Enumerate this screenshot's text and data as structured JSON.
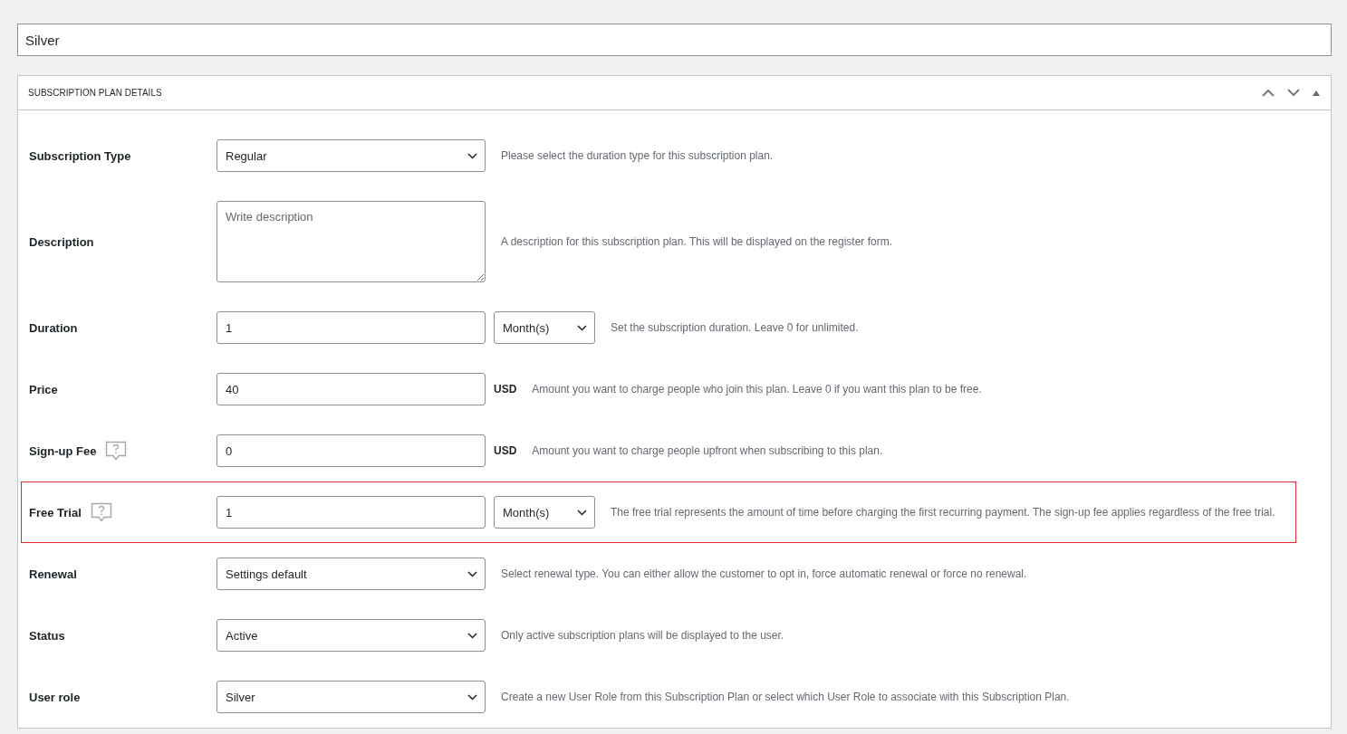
{
  "title_field": {
    "value": "Silver"
  },
  "panel": {
    "title": "SUBSCRIPTION PLAN DETAILS",
    "expanded": true,
    "rows": [
      {
        "kind": "select",
        "label": "Subscription Type",
        "help": false,
        "highlighted": false,
        "value": "Regular",
        "description": "Please select the duration type for this subscription plan."
      },
      {
        "kind": "textarea",
        "label": "Description",
        "help": false,
        "highlighted": false,
        "placeholder": "Write description",
        "description": "A description for this subscription plan. This will be displayed on the register form."
      },
      {
        "kind": "number-unit",
        "label": "Duration",
        "help": false,
        "highlighted": false,
        "value": "1",
        "unit": "Month(s)",
        "description": "Set the subscription duration. Leave 0 for unlimited."
      },
      {
        "kind": "number-currency",
        "label": "Price",
        "help": false,
        "highlighted": false,
        "value": "40",
        "currency": "USD",
        "description": "Amount you want to charge people who join this plan. Leave 0 if you want this plan to be free."
      },
      {
        "kind": "number-currency",
        "label": "Sign-up Fee",
        "help": true,
        "highlighted": false,
        "value": "0",
        "currency": "USD",
        "description": "Amount you want to charge people upfront when subscribing to this plan."
      },
      {
        "kind": "number-unit",
        "label": "Free Trial",
        "help": true,
        "highlighted": true,
        "value": "1",
        "unit": "Month(s)",
        "description": "The free trial represents the amount of time before charging the first recurring payment. The sign-up fee applies regardless of the free trial."
      },
      {
        "kind": "select",
        "label": "Renewal",
        "help": false,
        "highlighted": false,
        "value": "Settings default",
        "description": "Select renewal type. You can either allow the customer to opt in, force automatic renewal or force no renewal."
      },
      {
        "kind": "select",
        "label": "Status",
        "help": false,
        "highlighted": false,
        "value": "Active",
        "description": "Only active subscription plans will be displayed to the user."
      },
      {
        "kind": "select",
        "label": "User role",
        "help": false,
        "highlighted": false,
        "value": "Silver",
        "description": "Create a new User Role from this Subscription Plan or select which User Role to associate with this Subscription Plan."
      }
    ]
  }
}
